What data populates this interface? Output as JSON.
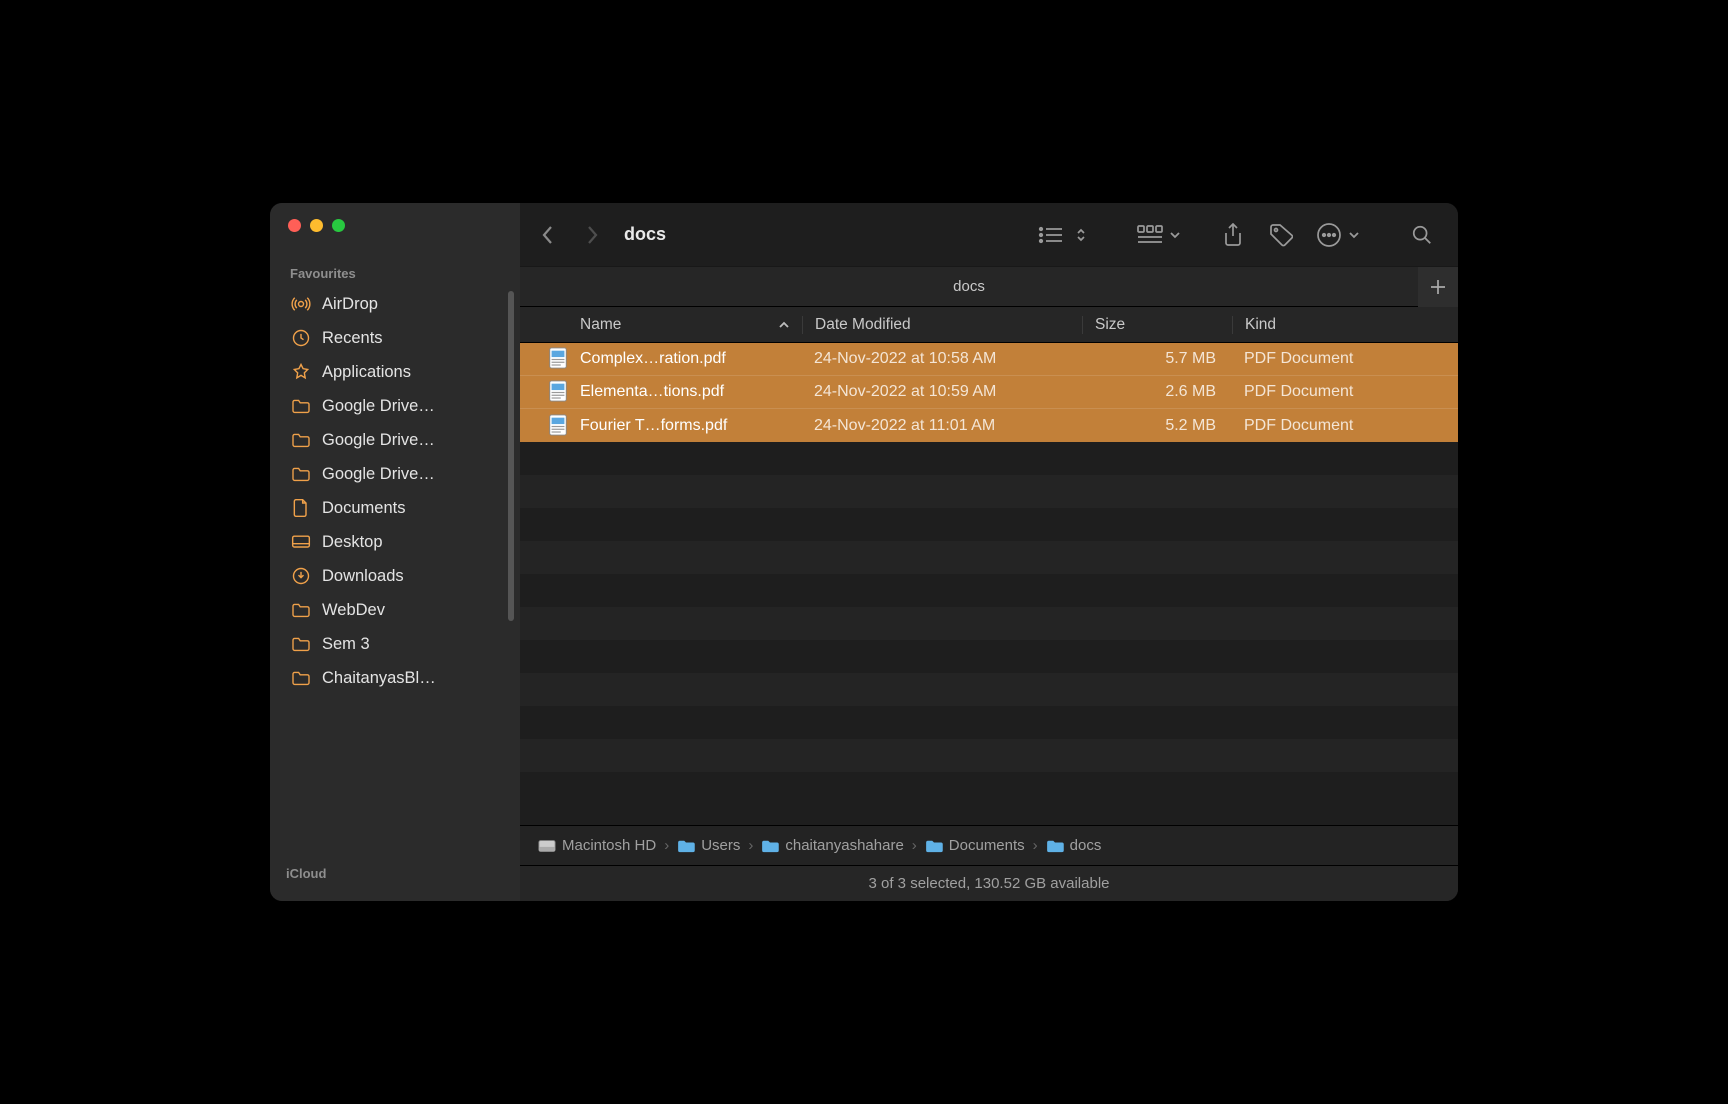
{
  "sidebar": {
    "sections": {
      "favourites": {
        "header": "Favourites",
        "items": [
          {
            "icon": "airdrop",
            "label": "AirDrop"
          },
          {
            "icon": "recents",
            "label": "Recents"
          },
          {
            "icon": "applications",
            "label": "Applications"
          },
          {
            "icon": "folder",
            "label": "Google Drive…"
          },
          {
            "icon": "folder",
            "label": "Google Drive…"
          },
          {
            "icon": "folder",
            "label": "Google Drive…"
          },
          {
            "icon": "documents",
            "label": "Documents"
          },
          {
            "icon": "desktop",
            "label": "Desktop"
          },
          {
            "icon": "downloads",
            "label": "Downloads"
          },
          {
            "icon": "folder",
            "label": "WebDev"
          },
          {
            "icon": "folder",
            "label": "Sem 3"
          },
          {
            "icon": "folder",
            "label": "ChaitanyasBl…"
          }
        ]
      },
      "icloud": {
        "header": "iCloud"
      }
    }
  },
  "toolbar": {
    "title": "docs"
  },
  "tab": {
    "title": "docs"
  },
  "columns": {
    "name": "Name",
    "date": "Date Modified",
    "size": "Size",
    "kind": "Kind"
  },
  "files": [
    {
      "name": "Complex…ration.pdf",
      "date": "24-Nov-2022 at 10:58 AM",
      "size": "5.7 MB",
      "kind": "PDF Document"
    },
    {
      "name": "Elementa…tions.pdf",
      "date": "24-Nov-2022 at 10:59 AM",
      "size": "2.6 MB",
      "kind": "PDF Document"
    },
    {
      "name": "Fourier T…forms.pdf",
      "date": "24-Nov-2022 at 11:01 AM",
      "size": "5.2 MB",
      "kind": "PDF Document"
    }
  ],
  "path": [
    "Macintosh HD",
    "Users",
    "chaitanyashahare",
    "Documents",
    "docs"
  ],
  "status": "3 of 3 selected, 130.52 GB available"
}
